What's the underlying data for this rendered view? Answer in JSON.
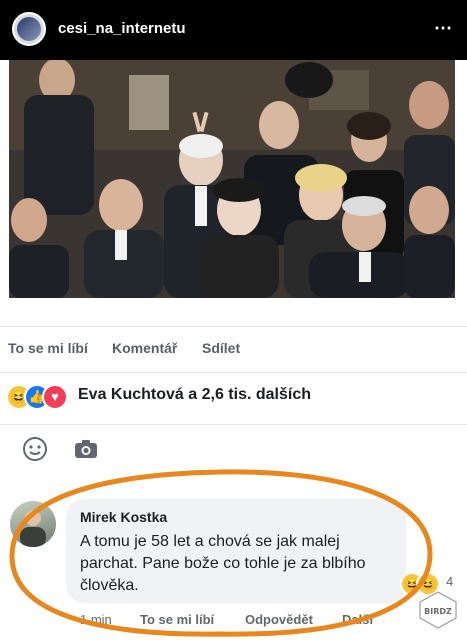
{
  "header": {
    "username": "cesi_na_internetu",
    "more_icon": "⋯"
  },
  "photo": {
    "description_icon": "photo-image"
  },
  "actions": {
    "like": "To se mi líbí",
    "comment": "Komentář",
    "share": "Sdílet"
  },
  "reactions": {
    "haha_icon": "😆",
    "like_icon": "👍",
    "love_icon": "♥",
    "summary": "Eva Kuchtová a 2,6 tis. dalších"
  },
  "comment": {
    "author": "Mirek Kostka",
    "text": "A tomu je 58 let a chová se jak malej parchat. Pane bože co tohle je za blbího člověka.",
    "reaction_icon": "😆",
    "reaction_count": "4",
    "time": "1 min",
    "like": "To se mi líbí",
    "reply": "Odpovědět",
    "more": "Další"
  },
  "watermark": {
    "text": "BIRDZ"
  },
  "colors": {
    "accent_orange": "#e8871e",
    "facebook_blue": "#1877f2",
    "header_bg": "#000000"
  }
}
